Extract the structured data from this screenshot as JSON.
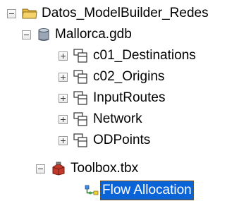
{
  "tree": {
    "root": {
      "label": "Datos_ModelBuilder_Redes",
      "icon": "folder-icon",
      "expanded": true
    },
    "geodatabase": {
      "label": "Mallorca.gdb",
      "icon": "geodatabase-icon",
      "expanded": true,
      "datasets": [
        {
          "label": "c01_Destinations",
          "icon": "feature-dataset-icon",
          "expanded": false
        },
        {
          "label": "c02_Origins",
          "icon": "feature-dataset-icon",
          "expanded": false
        },
        {
          "label": "InputRoutes",
          "icon": "feature-dataset-icon",
          "expanded": false
        },
        {
          "label": "Network",
          "icon": "feature-dataset-icon",
          "expanded": false
        },
        {
          "label": "ODPoints",
          "icon": "feature-dataset-icon",
          "expanded": false
        }
      ]
    },
    "toolbox": {
      "label": "Toolbox.tbx",
      "icon": "toolbox-icon",
      "expanded": true,
      "models": [
        {
          "label": "Flow Allocation",
          "icon": "model-icon",
          "selected": true
        }
      ]
    }
  },
  "colors": {
    "selection": "#0a64d8",
    "folder": "#f2c94c",
    "toolbox": "#c0392b"
  }
}
